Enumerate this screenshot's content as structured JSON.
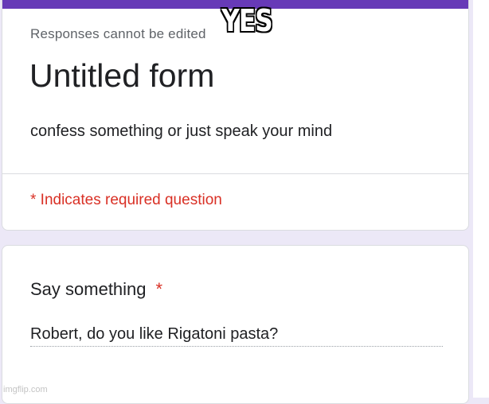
{
  "form": {
    "responses_note": "Responses cannot be edited",
    "title": "Untitled form",
    "description": "confess something or just speak your mind",
    "required_note": "* Indicates required question",
    "accent_color": "#673ab7",
    "required_color": "#d93025"
  },
  "question": {
    "title": "Say something",
    "required_mark": "*",
    "answer": "Robert, do you like Rigatoni pasta?"
  },
  "meme": {
    "caption": "YES"
  },
  "watermark": {
    "text": "imgflip.com"
  }
}
